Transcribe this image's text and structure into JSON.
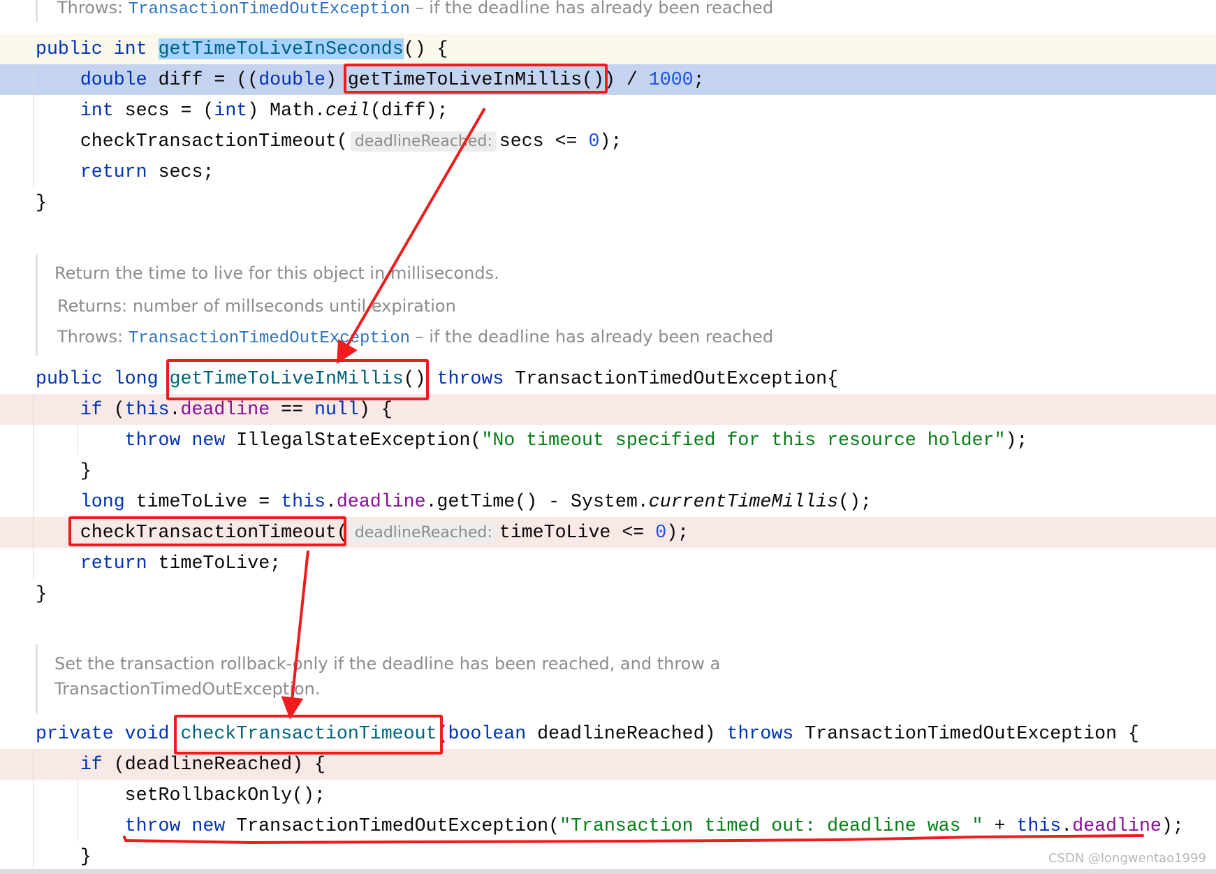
{
  "colors": {
    "keyword": "#0033b3",
    "string": "#067d17",
    "field": "#871094",
    "number": "#1750eb",
    "annotation_red": "#ee1c1c",
    "current_line_bg": "#c4d3ef",
    "caret_row_bg": "#fbf9ec",
    "breakpoint_row_bg": "#f8e8e6"
  },
  "docs": [
    {
      "lines": [
        [
          {
            "t": "Throws: "
          },
          {
            "t": "TransactionTimedOutException",
            "link": true
          },
          {
            "t": " – if the deadline has already been reached"
          }
        ]
      ]
    },
    {
      "lines": [
        [
          {
            "t": "Return the time to live for this object in milliseconds."
          }
        ],
        [
          {
            "t": "Returns: number of millseconds until expiration"
          }
        ],
        [
          {
            "t": "Throws: "
          },
          {
            "t": "TransactionTimedOutException",
            "link": true
          },
          {
            "t": " – if the deadline has already been reached"
          }
        ]
      ]
    },
    {
      "lines": [
        [
          {
            "t": "Set the transaction rollback-only if the deadline has been reached, and throw a"
          }
        ],
        [
          {
            "t": "TransactionTimedOutException."
          }
        ]
      ]
    }
  ],
  "code": [
    [
      {
        "t": "public ",
        "c": "kw"
      },
      {
        "t": "int ",
        "c": "kw"
      },
      {
        "t": "getTimeToLiveInSeconds",
        "c": "decl sel"
      },
      {
        "t": "() {"
      }
    ],
    [
      {
        "t": "    "
      },
      {
        "t": "double ",
        "c": "kw"
      },
      {
        "t": "diff = (("
      },
      {
        "t": "double",
        "c": "kw"
      },
      {
        "t": ") getTimeToLiveInMillis()) / "
      },
      {
        "t": "1000",
        "c": "num"
      },
      {
        "t": ";"
      }
    ],
    [
      {
        "t": "    "
      },
      {
        "t": "int ",
        "c": "kw"
      },
      {
        "t": "secs = ("
      },
      {
        "t": "int",
        "c": "kw"
      },
      {
        "t": ") Math."
      },
      {
        "t": "ceil",
        "c": "ital"
      },
      {
        "t": "(diff);"
      }
    ],
    [
      {
        "t": "    checkTransactionTimeout("
      },
      {
        "t": "deadlineReached:",
        "c": "hint"
      },
      {
        "t": "secs <= "
      },
      {
        "t": "0",
        "c": "num"
      },
      {
        "t": ");"
      }
    ],
    [
      {
        "t": "    "
      },
      {
        "t": "return ",
        "c": "kw"
      },
      {
        "t": "secs;"
      }
    ],
    [
      {
        "t": "}"
      }
    ],
    [
      {
        "t": "public ",
        "c": "kw"
      },
      {
        "t": "long ",
        "c": "kw"
      },
      {
        "t": "getTimeToLiveInMillis",
        "c": "decl"
      },
      {
        "t": "() "
      },
      {
        "t": "throws ",
        "c": "kw"
      },
      {
        "t": "TransactionTimedOutException{"
      }
    ],
    [
      {
        "t": "    "
      },
      {
        "t": "if ",
        "c": "kw"
      },
      {
        "t": "("
      },
      {
        "t": "this",
        "c": "kw"
      },
      {
        "t": "."
      },
      {
        "t": "deadline",
        "c": "fld"
      },
      {
        "t": " == "
      },
      {
        "t": "null",
        "c": "kw"
      },
      {
        "t": ") {"
      }
    ],
    [
      {
        "t": "        "
      },
      {
        "t": "throw new ",
        "c": "kw"
      },
      {
        "t": "IllegalStateException("
      },
      {
        "t": "\"No timeout specified for this resource holder\"",
        "c": "str"
      },
      {
        "t": ");"
      }
    ],
    [
      {
        "t": "    }"
      }
    ],
    [
      {
        "t": "    "
      },
      {
        "t": "long ",
        "c": "kw"
      },
      {
        "t": "timeToLive = "
      },
      {
        "t": "this",
        "c": "kw"
      },
      {
        "t": "."
      },
      {
        "t": "deadline",
        "c": "fld"
      },
      {
        "t": ".getTime() - System."
      },
      {
        "t": "currentTimeMillis",
        "c": "ital"
      },
      {
        "t": "();"
      }
    ],
    [
      {
        "t": "    checkTransactionTimeout("
      },
      {
        "t": "deadlineReached:",
        "c": "hint"
      },
      {
        "t": "timeToLive <= "
      },
      {
        "t": "0",
        "c": "num"
      },
      {
        "t": ");"
      }
    ],
    [
      {
        "t": "    "
      },
      {
        "t": "return ",
        "c": "kw"
      },
      {
        "t": "timeToLive;"
      }
    ],
    [
      {
        "t": "}"
      }
    ],
    [
      {
        "t": "private ",
        "c": "kw"
      },
      {
        "t": "void ",
        "c": "kw"
      },
      {
        "t": "checkTransactionTimeout",
        "c": "decl"
      },
      {
        "t": "("
      },
      {
        "t": "boolean ",
        "c": "kw"
      },
      {
        "t": "deadlineReached) "
      },
      {
        "t": "throws ",
        "c": "kw"
      },
      {
        "t": "TransactionTimedOutException {"
      }
    ],
    [
      {
        "t": "    "
      },
      {
        "t": "if ",
        "c": "kw"
      },
      {
        "t": "(deadlineReached) {"
      }
    ],
    [
      {
        "t": "        setRollbackOnly();"
      }
    ],
    [
      {
        "t": "        "
      },
      {
        "t": "throw new ",
        "c": "kw"
      },
      {
        "t": "TransactionTimedOutException("
      },
      {
        "t": "\"Transaction timed out: deadline was \"",
        "c": "str"
      },
      {
        "t": " + "
      },
      {
        "t": "this",
        "c": "kw"
      },
      {
        "t": "."
      },
      {
        "t": "deadline",
        "c": "fld"
      },
      {
        "t": ");"
      }
    ],
    [
      {
        "t": "    }"
      }
    ]
  ],
  "watermark": "CSDN @longwentao1999"
}
